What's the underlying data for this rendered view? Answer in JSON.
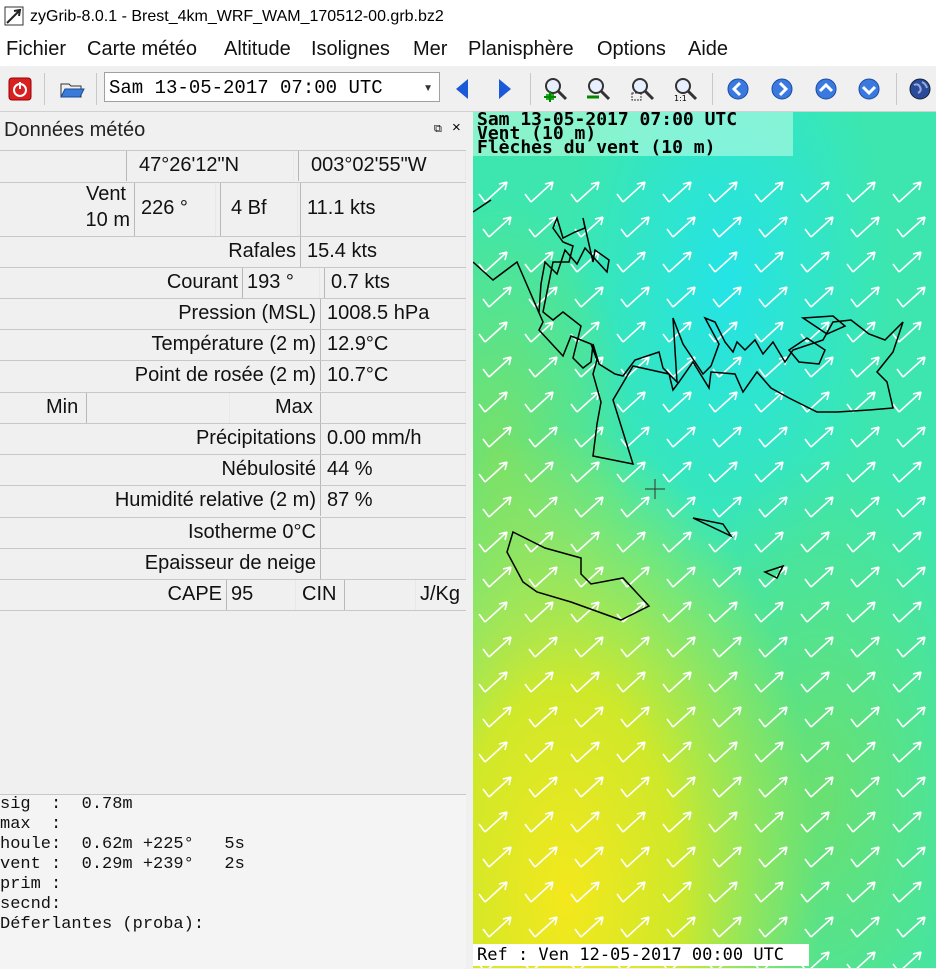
{
  "window": {
    "title": "zyGrib-8.0.1 - Brest_4km_WRF_WAM_170512-00.grb.bz2"
  },
  "menu": [
    "Fichier",
    "Carte météo",
    "Altitude",
    "Isolignes",
    "Mer",
    "Planisphère",
    "Options",
    "Aide"
  ],
  "toolbar": {
    "date_value": "Sam 13-05-2017 07:00 UTC",
    "icons": [
      "power-icon",
      "open-folder-icon",
      "prev-arrow-icon",
      "next-arrow-icon",
      "zoom-in-icon",
      "zoom-out-icon",
      "zoom-selection-icon",
      "zoom-1-1-icon",
      "nav-left-icon",
      "nav-right-icon",
      "nav-up-icon",
      "nav-down-icon",
      "globe-icon"
    ]
  },
  "panel": {
    "title": "Données météo",
    "lat": "47°26'12\"N",
    "lon": "003°02'55\"W",
    "wind_label_1": "Vent",
    "wind_label_2": "10 m",
    "wind_dir": "226 °",
    "wind_bf": "4 Bf",
    "wind_speed": "11.1  kts",
    "gust_label": "Rafales",
    "gust_value": "15.4  kts",
    "current_label": "Courant",
    "current_dir": "193 °",
    "current_speed": "0.7  kts",
    "pressure_label": "Pression (MSL)",
    "pressure_value": "1008.5 hPa",
    "temp_label": "Température (2 m)",
    "temp_value": "12.9°C",
    "dew_label": "Point de rosée (2 m)",
    "dew_value": "10.7°C",
    "min_label": "Min",
    "max_label": "Max",
    "precip_label": "Précipitations",
    "precip_value": "0.00 mm/h",
    "cloud_label": "Nébulosité",
    "cloud_value": "44 %",
    "hum_label": "Humidité relative (2 m)",
    "hum_value": "87 %",
    "iso_label": "Isotherme 0°C",
    "snow_label": "Epaisseur de neige",
    "cape_label": "CAPE",
    "cape_value": "95",
    "cin_label": "CIN",
    "cape_unit": "J/Kg"
  },
  "waves": {
    "sig": "sig  :  0.78m",
    "max": "max  :",
    "houle": "houle:  0.62m +225°   5s",
    "vent": "vent :  0.29m +239°   2s",
    "prim": "prim :",
    "secnd": "secnd:",
    "defer": "Déferlantes (proba):"
  },
  "map": {
    "header_date": "Sam 13-05-2017 07:00 UTC",
    "header_layer": "Vent (10 m)",
    "header_arrows": "Flèches du vent (10 m)",
    "ref": "Ref : Ven 12-05-2017 00:00 UTC",
    "colors": {
      "sea_green": "#40e0a0",
      "sea_cyan": "#20e8e0",
      "land_green": "#70e060",
      "yellow": "#f0e020"
    }
  }
}
